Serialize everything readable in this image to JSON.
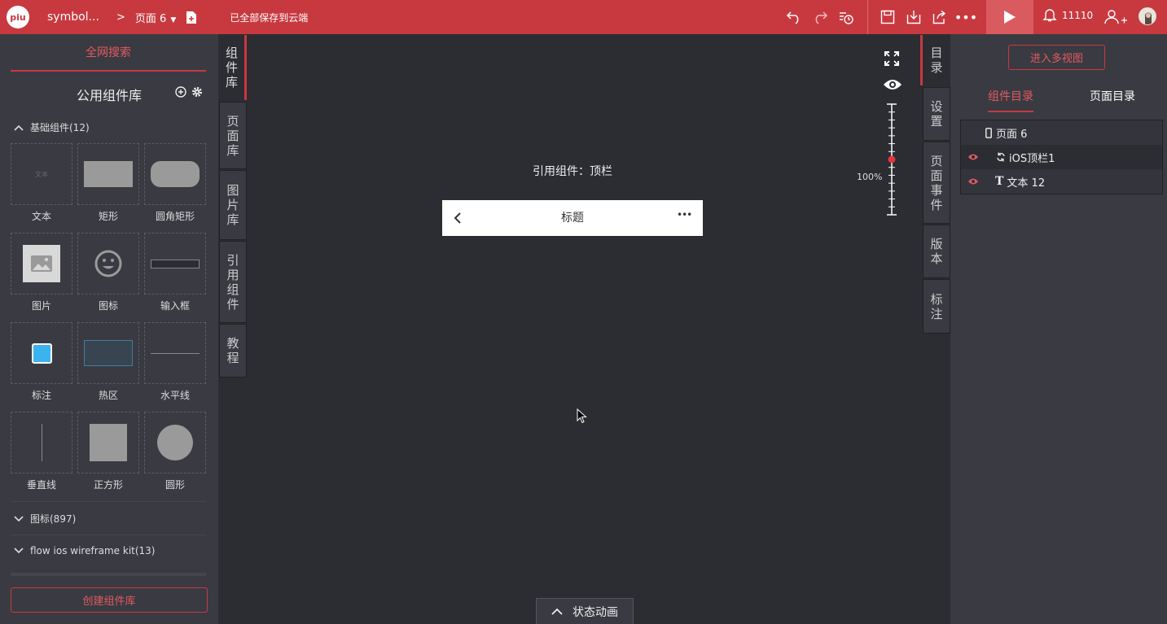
{
  "colors": {
    "brand": "#c8393f",
    "bg": "#2c2c33",
    "panel": "#3a3a42"
  },
  "header": {
    "logo": "piu",
    "project_name": "symbol...",
    "separator": ">",
    "page_name": "页面 6",
    "save_status": "已全部保存到云端",
    "notification_count": "11110"
  },
  "left_panel": {
    "search_tab": "全网搜索",
    "library_title": "公用组件库",
    "groups": [
      {
        "label": "基础组件(12)"
      },
      {
        "label": "图标(897)"
      },
      {
        "label": "flow ios wireframe kit(13)"
      }
    ],
    "components": [
      {
        "label": "文本",
        "thumb_text": "文本"
      },
      {
        "label": "矩形"
      },
      {
        "label": "圆角矩形"
      },
      {
        "label": "图片"
      },
      {
        "label": "图标"
      },
      {
        "label": "输入框"
      },
      {
        "label": "标注"
      },
      {
        "label": "热区"
      },
      {
        "label": "水平线"
      },
      {
        "label": "垂直线"
      },
      {
        "label": "正方形"
      },
      {
        "label": "圆形"
      }
    ],
    "create_button": "创建组件库"
  },
  "left_tabs": [
    "组件库",
    "页面库",
    "图片库",
    "引用组件",
    "教程"
  ],
  "canvas": {
    "reference_label": "引用组件：顶栏",
    "mock_title": "标题",
    "zoom": "100%",
    "zoom_level": 0.5,
    "state_animation": "状态动画"
  },
  "right_tabs": [
    "目录",
    "设置",
    "页面事件",
    "版本",
    "标注"
  ],
  "right_panel": {
    "multi_view_button": "进入多视图",
    "tabs": [
      "组件目录",
      "页面目录"
    ],
    "tree": [
      {
        "label": "页面 6",
        "icon": "phone-icon"
      },
      {
        "label": "iOS顶栏1",
        "icon": "symbol-link-icon"
      },
      {
        "label": "文本 12",
        "icon": "text-type-icon"
      }
    ]
  }
}
